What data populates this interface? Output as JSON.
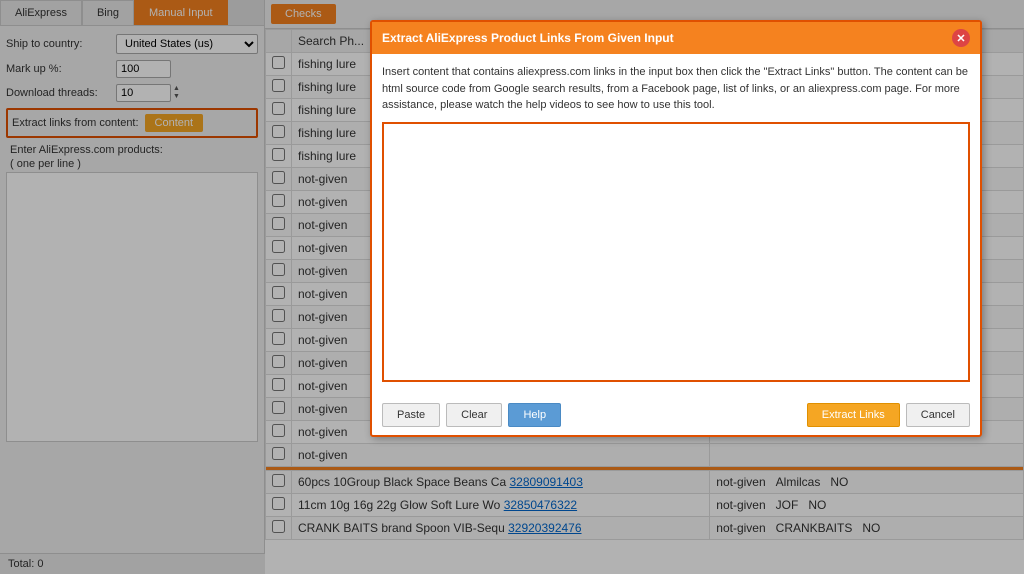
{
  "tabs": {
    "items": [
      {
        "label": "AliExpress",
        "active": false
      },
      {
        "label": "Bing",
        "active": false
      },
      {
        "label": "Manual Input",
        "active": true
      }
    ]
  },
  "sidebar": {
    "ship_to_label": "Ship to country:",
    "ship_to_value": "United States (us)",
    "markup_label": "Mark up %:",
    "markup_value": "100",
    "download_threads_label": "Download threads:",
    "download_threads_value": "10",
    "extract_label": "Extract links from content:",
    "content_btn_label": "Content",
    "products_label": "Enter AliExpress.com products:",
    "products_sublabel": "( one per line )",
    "total_label": "Total: 0"
  },
  "checks_bar": {
    "button_label": "Checks"
  },
  "table": {
    "headers": [
      "",
      "Search Ph...",
      ""
    ],
    "rows": [
      {
        "checked": false,
        "search": "fishing lure",
        "extra": ""
      },
      {
        "checked": false,
        "search": "fishing lure",
        "extra": ""
      },
      {
        "checked": false,
        "search": "fishing lure",
        "extra": ""
      },
      {
        "checked": false,
        "search": "fishing lure",
        "extra": ""
      },
      {
        "checked": false,
        "search": "fishing lure",
        "extra": ""
      },
      {
        "checked": false,
        "search": "not-given",
        "extra": ""
      },
      {
        "checked": false,
        "search": "not-given",
        "extra": ""
      },
      {
        "checked": false,
        "search": "not-given",
        "extra": ""
      },
      {
        "checked": false,
        "search": "not-given",
        "extra": ""
      },
      {
        "checked": false,
        "search": "not-given",
        "extra": ""
      },
      {
        "checked": false,
        "search": "not-given",
        "extra": ""
      },
      {
        "checked": false,
        "search": "not-given",
        "extra": ""
      },
      {
        "checked": false,
        "search": "not-given",
        "extra": ""
      },
      {
        "checked": false,
        "search": "not-given",
        "extra": ""
      },
      {
        "checked": false,
        "search": "not-given",
        "extra": ""
      },
      {
        "checked": false,
        "search": "not-given",
        "extra": ""
      },
      {
        "checked": false,
        "search": "not-given",
        "extra": ""
      },
      {
        "checked": false,
        "search": "not-given",
        "extra": ""
      }
    ],
    "bottom_rows": [
      {
        "product": "60pcs 10Group Black Space Beans Ca",
        "link": "32809091403",
        "extra1": "not-given",
        "extra2": "Almilcas",
        "extra3": "NO"
      },
      {
        "product": "11cm 10g 16g 22g Glow Soft Lure Wo",
        "link": "32850476322",
        "extra1": "not-given",
        "extra2": "JOF",
        "extra3": "NO"
      },
      {
        "product": "CRANK BAITS brand Spoon VIB-Sequ",
        "link": "32920392476",
        "extra1": "not-given",
        "extra2": "CRANKBAITS",
        "extra3": "NO"
      }
    ]
  },
  "modal": {
    "title": "Extract AliExpress Product Links From Given Input",
    "description": "Insert content that contains aliexpress.com links in the input box then click the \"Extract Links\" button. The content can be html source code from Google search results, from a Facebook page, list of links, or an aliexpress.com page. For more assistance, please watch the help videos to see how to use this tool.",
    "textarea_placeholder": "",
    "paste_label": "Paste",
    "clear_label": "Clear",
    "help_label": "Help",
    "extract_label": "Extract Links",
    "cancel_label": "Cancel"
  }
}
